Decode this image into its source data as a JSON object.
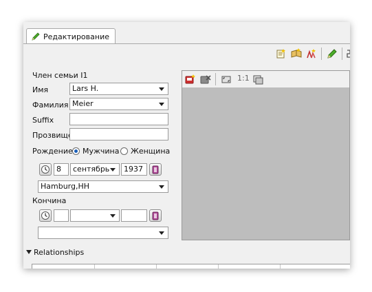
{
  "tab": {
    "label": "Редактирование"
  },
  "form": {
    "title": "Член семьи I1",
    "first_name_label": "Имя",
    "first_name_value": "Lars H.",
    "last_name_label": "Фамилия",
    "last_name_value": "Meier",
    "suffix_label": "Suffix",
    "suffix_value": "",
    "nickname_label": "Прозвище",
    "nickname_value": ""
  },
  "birth": {
    "label": "Рождение",
    "sex_male": "Мужчина",
    "sex_female": "Женщина",
    "selected_sex": "male",
    "day": "8",
    "month": "сентябрь",
    "year": "1937",
    "place": "Hamburg,HH"
  },
  "death": {
    "label": "Кончина",
    "day": "",
    "month": "",
    "year": "",
    "place": ""
  },
  "image_panel": {
    "zoom_label": "1:1"
  },
  "relationships": {
    "label": "Relationships"
  },
  "colors": {
    "accent": "#1c5fb8",
    "image_bg": "#bdbdbd",
    "window_bg": "#f0f0f0"
  }
}
